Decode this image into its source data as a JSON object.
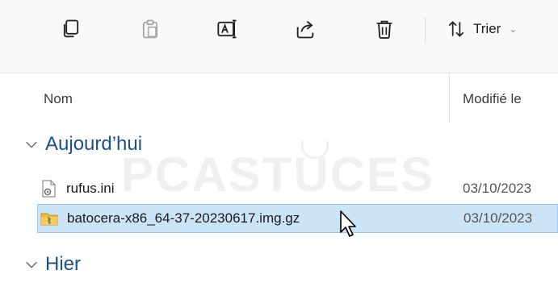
{
  "toolbar": {
    "buttons": [
      {
        "name": "copy-button",
        "icon": "copy-icon"
      },
      {
        "name": "paste-button",
        "icon": "paste-icon",
        "disabled": true
      },
      {
        "name": "rename-button",
        "icon": "rename-icon"
      },
      {
        "name": "share-button",
        "icon": "share-icon"
      },
      {
        "name": "delete-button",
        "icon": "trash-icon"
      }
    ],
    "sort_label": "Trier",
    "sort_icon": "sort-arrows-icon"
  },
  "columns": {
    "name": "Nom",
    "modified": "Modifié le"
  },
  "groups": [
    {
      "label": "Aujourd’hui",
      "files": [
        {
          "name": "rufus.ini",
          "icon": "settings-file-icon",
          "date": "03/10/2023",
          "selected": false
        },
        {
          "name": "batocera-x86_64-37-20230617.img.gz",
          "icon": "archive-file-icon",
          "date": "03/10/2023",
          "selected": true
        }
      ]
    },
    {
      "label": "Hier",
      "files": []
    }
  ],
  "watermark": "PCASTUCES",
  "colors": {
    "group_text": "#1c4f8f",
    "selection_bg": "#cce4f7",
    "selection_border": "#99c9ef",
    "toolbar_bg": "#f9f9f9"
  }
}
